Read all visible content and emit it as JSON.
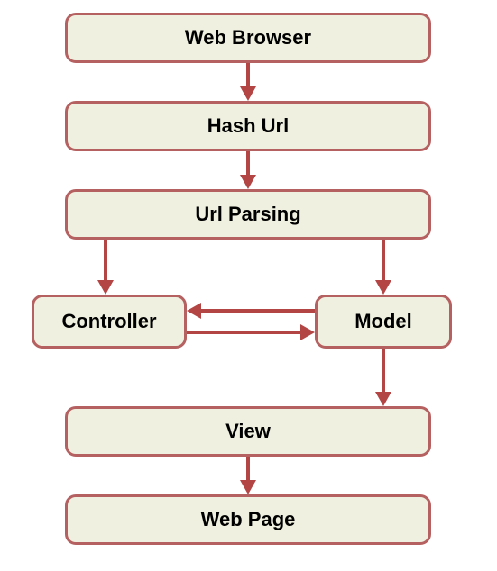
{
  "nodes": {
    "web_browser": "Web Browser",
    "hash_url": "Hash Url",
    "url_parsing": "Url Parsing",
    "controller": "Controller",
    "model": "Model",
    "view": "View",
    "web_page": "Web Page"
  },
  "colors": {
    "node_fill": "#eff0df",
    "node_border": "#b66161",
    "arrow": "#b44545"
  },
  "edges": [
    {
      "from": "web_browser",
      "to": "hash_url"
    },
    {
      "from": "hash_url",
      "to": "url_parsing"
    },
    {
      "from": "url_parsing",
      "to": "controller"
    },
    {
      "from": "url_parsing",
      "to": "model"
    },
    {
      "from": "model",
      "to": "controller"
    },
    {
      "from": "controller",
      "to": "model"
    },
    {
      "from": "model",
      "to": "view"
    },
    {
      "from": "view",
      "to": "web_page"
    }
  ]
}
